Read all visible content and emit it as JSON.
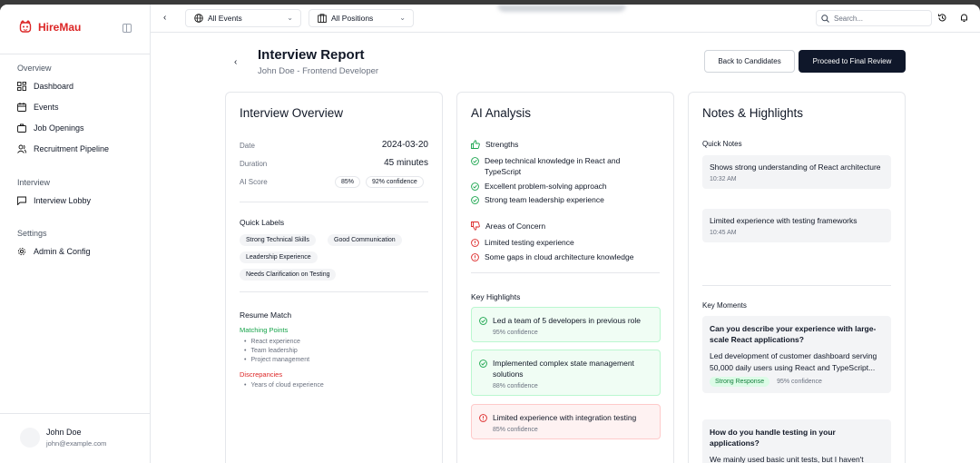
{
  "app": {
    "brand": "HireMau"
  },
  "sidebar": {
    "groups": [
      {
        "label": "Overview",
        "items": [
          {
            "label": "Dashboard",
            "icon": "dashboard-icon"
          },
          {
            "label": "Events",
            "icon": "calendar-icon"
          },
          {
            "label": "Job Openings",
            "icon": "briefcase-icon"
          },
          {
            "label": "Recruitment Pipeline",
            "icon": "users-icon"
          }
        ]
      },
      {
        "label": "Interview",
        "items": [
          {
            "label": "Interview Lobby",
            "icon": "message-icon"
          }
        ]
      },
      {
        "label": "Settings",
        "items": [
          {
            "label": "Admin & Config",
            "icon": "gear-icon"
          }
        ]
      }
    ],
    "user": {
      "name": "John Doe",
      "email": "john@example.com"
    }
  },
  "topbar": {
    "events_select": "All Events",
    "positions_select": "All Positions",
    "search_placeholder": "Search..."
  },
  "header": {
    "title": "Interview Report",
    "subtitle": "John Doe - Frontend Developer",
    "back_button": "Back to Candidates",
    "proceed_button": "Proceed to Final Review"
  },
  "overview": {
    "title": "Interview Overview",
    "date_label": "Date",
    "date_value": "2024-03-20",
    "duration_label": "Duration",
    "duration_value": "45 minutes",
    "score_label": "AI Score",
    "score_value": "85%",
    "score_confidence": "92% confidence",
    "quick_labels_title": "Quick Labels",
    "quick_labels": [
      "Strong Technical Skills",
      "Good Communication",
      "Leadership Experience",
      "Needs Clarification on Testing"
    ],
    "resume_title": "Resume Match",
    "matching_title": "Matching Points",
    "matching": [
      "React experience",
      "Team leadership",
      "Project management"
    ],
    "discrepancies_title": "Discrepancies",
    "discrepancies": [
      "Years of cloud experience"
    ]
  },
  "ai": {
    "title": "AI Analysis",
    "strengths_title": "Strengths",
    "strengths": [
      "Deep technical knowledge in React and TypeScript",
      "Excellent problem-solving approach",
      "Strong team leadership experience"
    ],
    "concerns_title": "Areas of Concern",
    "concerns": [
      "Limited testing experience",
      "Some gaps in cloud architecture knowledge"
    ],
    "highlights_title": "Key Highlights",
    "highlights": [
      {
        "text": "Led a team of 5 developers in previous role",
        "confidence": "95% confidence",
        "kind": "positive"
      },
      {
        "text": "Implemented complex state management solutions",
        "confidence": "88% confidence",
        "kind": "positive"
      },
      {
        "text": "Limited experience with integration testing",
        "confidence": "85% confidence",
        "kind": "negative"
      }
    ]
  },
  "notes": {
    "title": "Notes & Highlights",
    "quick_notes_title": "Quick Notes",
    "quick_notes": [
      {
        "text": "Shows strong understanding of React architecture",
        "time": "10:32 AM"
      },
      {
        "text": "Limited experience with testing frameworks",
        "time": "10:45 AM"
      }
    ],
    "key_moments_title": "Key Moments",
    "moments": [
      {
        "question": "Can you describe your experience with large-scale React applications?",
        "answer": "Led development of customer dashboard serving 50,000 daily users using React and TypeScript...",
        "badge": "Strong Response",
        "confidence": "95% confidence"
      },
      {
        "question": "How do you handle testing in your applications?",
        "answer": "We mainly used basic unit tests, but I haven't"
      }
    ]
  },
  "colors": {
    "brand": "#dc2626",
    "primary": "#0f172a",
    "positive": "#16a34a",
    "negative": "#dc2626"
  }
}
